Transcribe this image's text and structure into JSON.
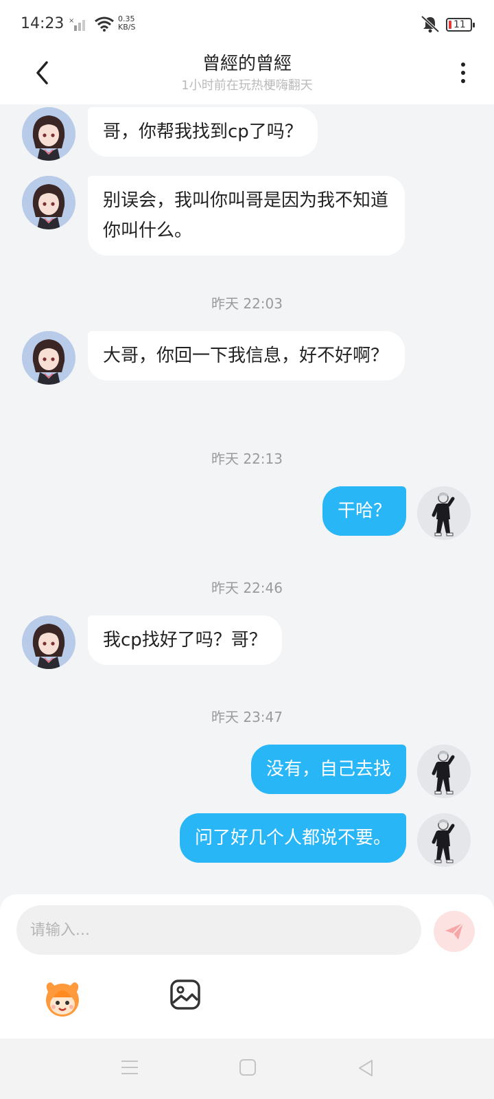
{
  "status_bar": {
    "time": "14:23",
    "net_speed_value": "0.35",
    "net_speed_unit": "KB/S",
    "battery_level": "11",
    "battery_color": "#e53935"
  },
  "header": {
    "title": "曾經的曾經",
    "subtitle": "1小时前在玩热梗嗨翻天"
  },
  "messages": [
    {
      "side": "left",
      "text": "哥，你帮我找到cp了吗？"
    },
    {
      "side": "left",
      "text": "别误会，我叫你叫哥是因为我不知道你叫什么。"
    },
    {
      "timestamp": "昨天 22:03"
    },
    {
      "side": "left",
      "text": "大哥，你回一下我信息，好不好啊？"
    },
    {
      "timestamp": "昨天 22:13"
    },
    {
      "side": "right",
      "text": "干哈？"
    },
    {
      "timestamp": "昨天 22:46"
    },
    {
      "side": "left",
      "text": "我cp找好了吗？哥？"
    },
    {
      "timestamp": "昨天 23:47"
    },
    {
      "side": "right",
      "text": "没有，自己去找"
    },
    {
      "side": "right",
      "text": "问了好几个人都说不要。"
    }
  ],
  "input": {
    "placeholder": "请输入..."
  },
  "icons": {
    "back": "chevron-left-icon",
    "more": "more-vertical-icon",
    "send": "send-icon",
    "emoji": "emoji-mascot-icon",
    "image": "image-icon"
  },
  "colors": {
    "outgoing_bubble": "#29b6f6",
    "incoming_bubble": "#ffffff",
    "send_button_bg": "#fde2e2",
    "send_icon": "#f7a7a7"
  }
}
